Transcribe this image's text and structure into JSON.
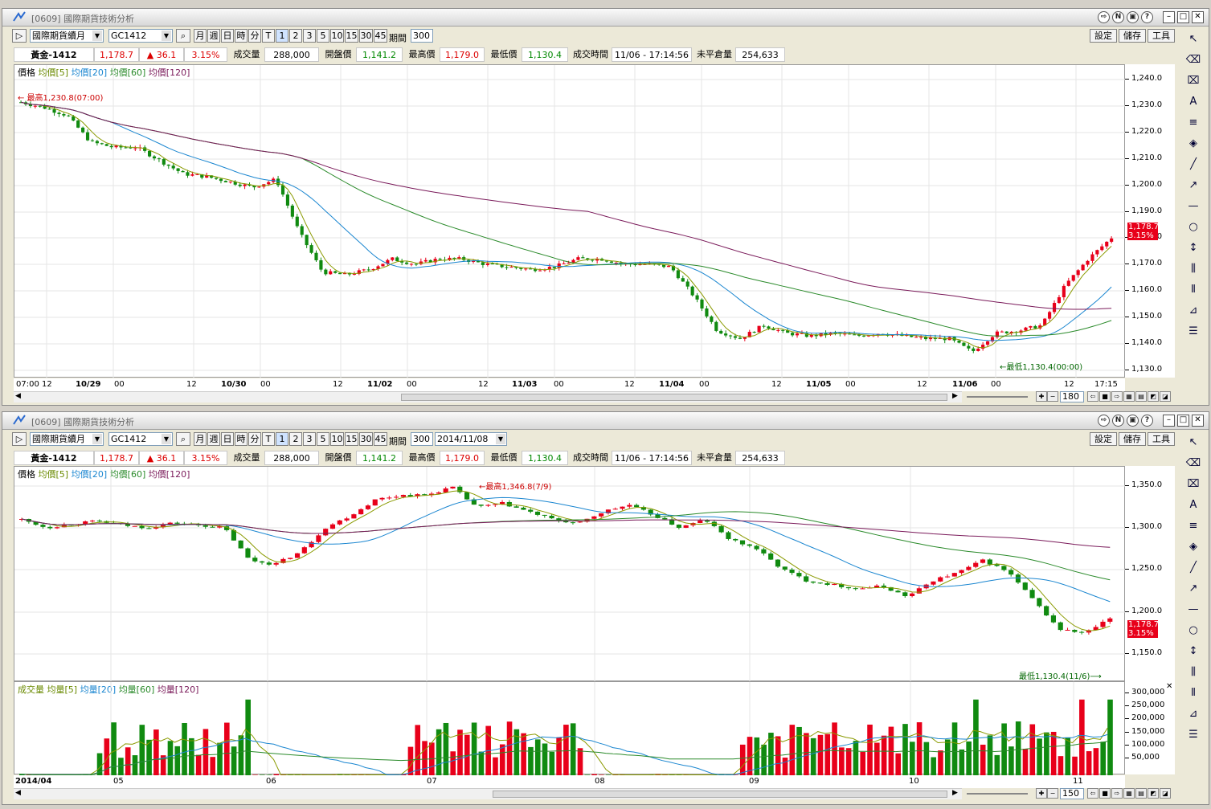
{
  "windows": [
    {
      "title": "[0609] 國際期貨技術分析",
      "market": "國際期貨續月",
      "symbol": "GC1412",
      "period_buttons": [
        "月",
        "週",
        "日",
        "時",
        "分",
        "T",
        "1",
        "2",
        "3",
        "5",
        "10",
        "15",
        "30",
        "45"
      ],
      "period_label": "期間",
      "period_value": "300",
      "date_value": "",
      "settings": "設定",
      "save": "儲存",
      "tools": "工具",
      "quote": {
        "name": "黃金-1412",
        "price": "1,178.7",
        "change": "▲ 36.1",
        "pct": "3.15%",
        "vol_label": "成交量",
        "vol": "288,000",
        "open_label": "開盤價",
        "open": "1,141.2",
        "high_label": "最高價",
        "high": "1,179.0",
        "low_label": "最低價",
        "low": "1,130.4",
        "time_label": "成交時間",
        "time": "11/06 - 17:14:56",
        "oi_label": "未平倉量",
        "oi": "254,633"
      },
      "legend": {
        "price": "價格",
        "ma5": "均價[5]",
        "ma20": "均價[20]",
        "ma60": "均價[60]",
        "ma120": "均價[120]"
      },
      "y_ticks": [
        "1,240.0",
        "1,230.0",
        "1,220.0",
        "1,210.0",
        "1,200.0",
        "1,190.0",
        "1,180.0",
        "1,170.0",
        "1,160.0",
        "1,150.0",
        "1,140.0",
        "1,130.0"
      ],
      "x_labels": [
        "07:00 12",
        "10/29",
        "00",
        "12",
        "10/30",
        "00",
        "12",
        "11/02",
        "00",
        "12",
        "11/03",
        "00",
        "12",
        "11/04",
        "00",
        "12",
        "11/05",
        "00",
        "12",
        "11/06",
        "00",
        "12",
        "17:15"
      ],
      "price_tag": [
        "1,178.7",
        "3.15%"
      ],
      "note_high": "← 最高1,230.8(07:00)",
      "note_low": "←最低1,130.4(00:00)",
      "zoom_value": "180",
      "chart_data": {
        "type": "candlestick",
        "title": "黃金-1412",
        "yrange": [
          1125,
          1243
        ],
        "series": [
          {
            "name": "均價[5]"
          },
          {
            "name": "均價[20]"
          },
          {
            "name": "均價[60]"
          },
          {
            "name": "均價[120]"
          }
        ],
        "high": 1230.8,
        "low": 1130.4,
        "last": 1178.7
      }
    },
    {
      "title": "[0609] 國際期貨技術分析",
      "market": "國際期貨續月",
      "symbol": "GC1412",
      "period_buttons": [
        "月",
        "週",
        "日",
        "時",
        "分",
        "T",
        "1",
        "2",
        "3",
        "5",
        "10",
        "15",
        "30",
        "45"
      ],
      "period_label": "期間",
      "period_value": "300",
      "date_value": "2014/11/08",
      "settings": "設定",
      "save": "儲存",
      "tools": "工具",
      "quote": {
        "name": "黃金-1412",
        "price": "1,178.7",
        "change": "▲ 36.1",
        "pct": "3.15%",
        "vol_label": "成交量",
        "vol": "288,000",
        "open_label": "開盤價",
        "open": "1,141.2",
        "high_label": "最高價",
        "high": "1,179.0",
        "low_label": "最低價",
        "low": "1,130.4",
        "time_label": "成交時間",
        "time": "11/06 - 17:14:56",
        "oi_label": "未平倉量",
        "oi": "254,633"
      },
      "legend": {
        "price": "價格",
        "ma5": "均價[5]",
        "ma20": "均價[20]",
        "ma60": "均價[60]",
        "ma120": "均價[120]"
      },
      "vol_legend": {
        "vol": "成交量",
        "ma5": "均量[5]",
        "ma20": "均量[20]",
        "ma60": "均量[60]",
        "ma120": "均量[120]"
      },
      "y_ticks": [
        "1,350.0",
        "1,300.0",
        "1,250.0",
        "1,200.0",
        "1,150.0"
      ],
      "vol_ticks": [
        "300,000",
        "250,000",
        "200,000",
        "150,000",
        "100,000",
        "50,000"
      ],
      "x_labels": [
        "2014/04",
        "05",
        "06",
        "07",
        "08",
        "09",
        "10",
        "11"
      ],
      "price_tag": [
        "1,178.7",
        "3.15%"
      ],
      "note_high": "←最高1,346.8(7/9)",
      "note_low": "最低1,130.4(11/6)⟶",
      "zoom_value": "150",
      "chart_data": {
        "type": "candlestick",
        "title": "黃金-1412",
        "yrange": [
          1100,
          1365
        ],
        "series": [
          {
            "name": "均價[5]"
          },
          {
            "name": "均價[20]"
          },
          {
            "name": "均價[60]"
          },
          {
            "name": "均價[120]"
          }
        ],
        "high": 1346.8,
        "low": 1130.4,
        "last": 1178.7,
        "volume_range": [
          0,
          320000
        ]
      }
    }
  ],
  "colors": {
    "up": "#e8001a",
    "down": "#108a10",
    "ma5": "#8a9a00",
    "ma20": "#1a86d0",
    "ma60": "#2a8a2a",
    "ma120": "#7a1a5a"
  }
}
